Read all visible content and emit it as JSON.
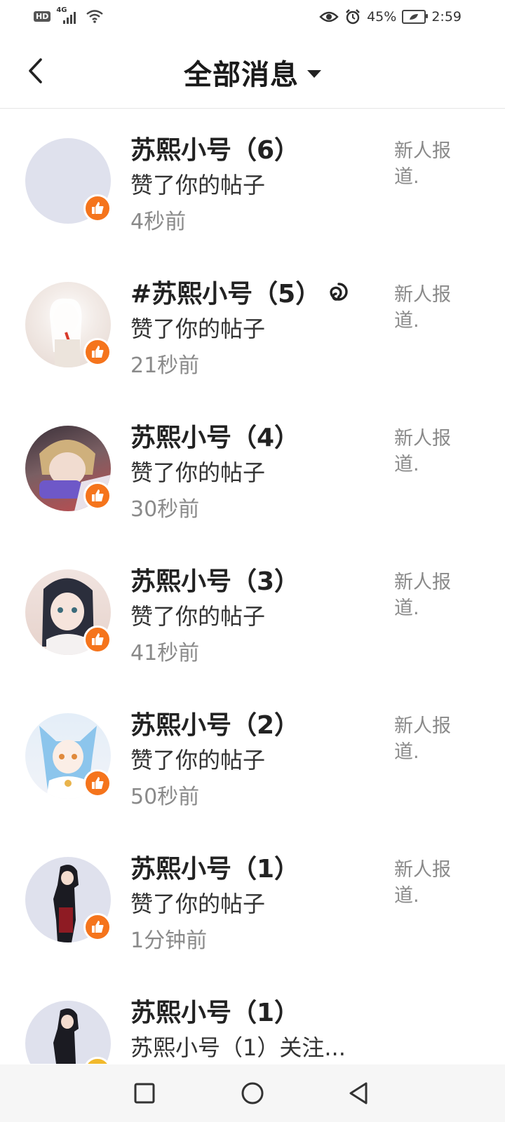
{
  "status_bar": {
    "hd": "HD",
    "network": "4G",
    "battery": "45%",
    "time": "2:59",
    "icons": [
      "eye-icon",
      "alarm-icon",
      "battery-icon"
    ]
  },
  "header": {
    "title": "全部消息"
  },
  "items": [
    {
      "name": "苏熙小号（6）",
      "action": "赞了你的帖子",
      "time": "4秒前",
      "post": "新人报道.",
      "avatar_color": "#dfe1ed",
      "badge_icon": "thumbs-up-icon"
    },
    {
      "name": "#苏熙小号（5）",
      "action": "赞了你的帖子",
      "time": "21秒前",
      "post": "新人报道.",
      "avatar_color": "#efe7e3",
      "badge_icon": "thumbs-up-icon"
    },
    {
      "name": "苏熙小号（4）",
      "action": "赞了你的帖子",
      "time": "30秒前",
      "post": "新人报道.",
      "avatar_color": "#8f7276",
      "badge_icon": "thumbs-up-icon"
    },
    {
      "name": "苏熙小号（3）",
      "action": "赞了你的帖子",
      "time": "41秒前",
      "post": "新人报道.",
      "avatar_color": "#e9d9d4",
      "badge_icon": "thumbs-up-icon"
    },
    {
      "name": "苏熙小号（2）",
      "action": "赞了你的帖子",
      "time": "50秒前",
      "post": "新人报道.",
      "avatar_color": "#d7e6f4",
      "badge_icon": "thumbs-up-icon"
    },
    {
      "name": "苏熙小号（1）",
      "action": "赞了你的帖子",
      "time": "1分钟前",
      "post": "新人报道.",
      "avatar_color": "#dfe1ed",
      "badge_icon": "thumbs-up-icon"
    },
    {
      "name": "苏熙小号（1）",
      "action": "苏熙小号（1）关注...",
      "time": "",
      "post": "",
      "avatar_color": "#dfe1ed",
      "badge_icon": "thumbs-up-icon"
    }
  ],
  "accent_color": "#f5741c",
  "nav_bar": {
    "icons": [
      "recent-apps-icon",
      "home-icon",
      "back-icon"
    ]
  }
}
